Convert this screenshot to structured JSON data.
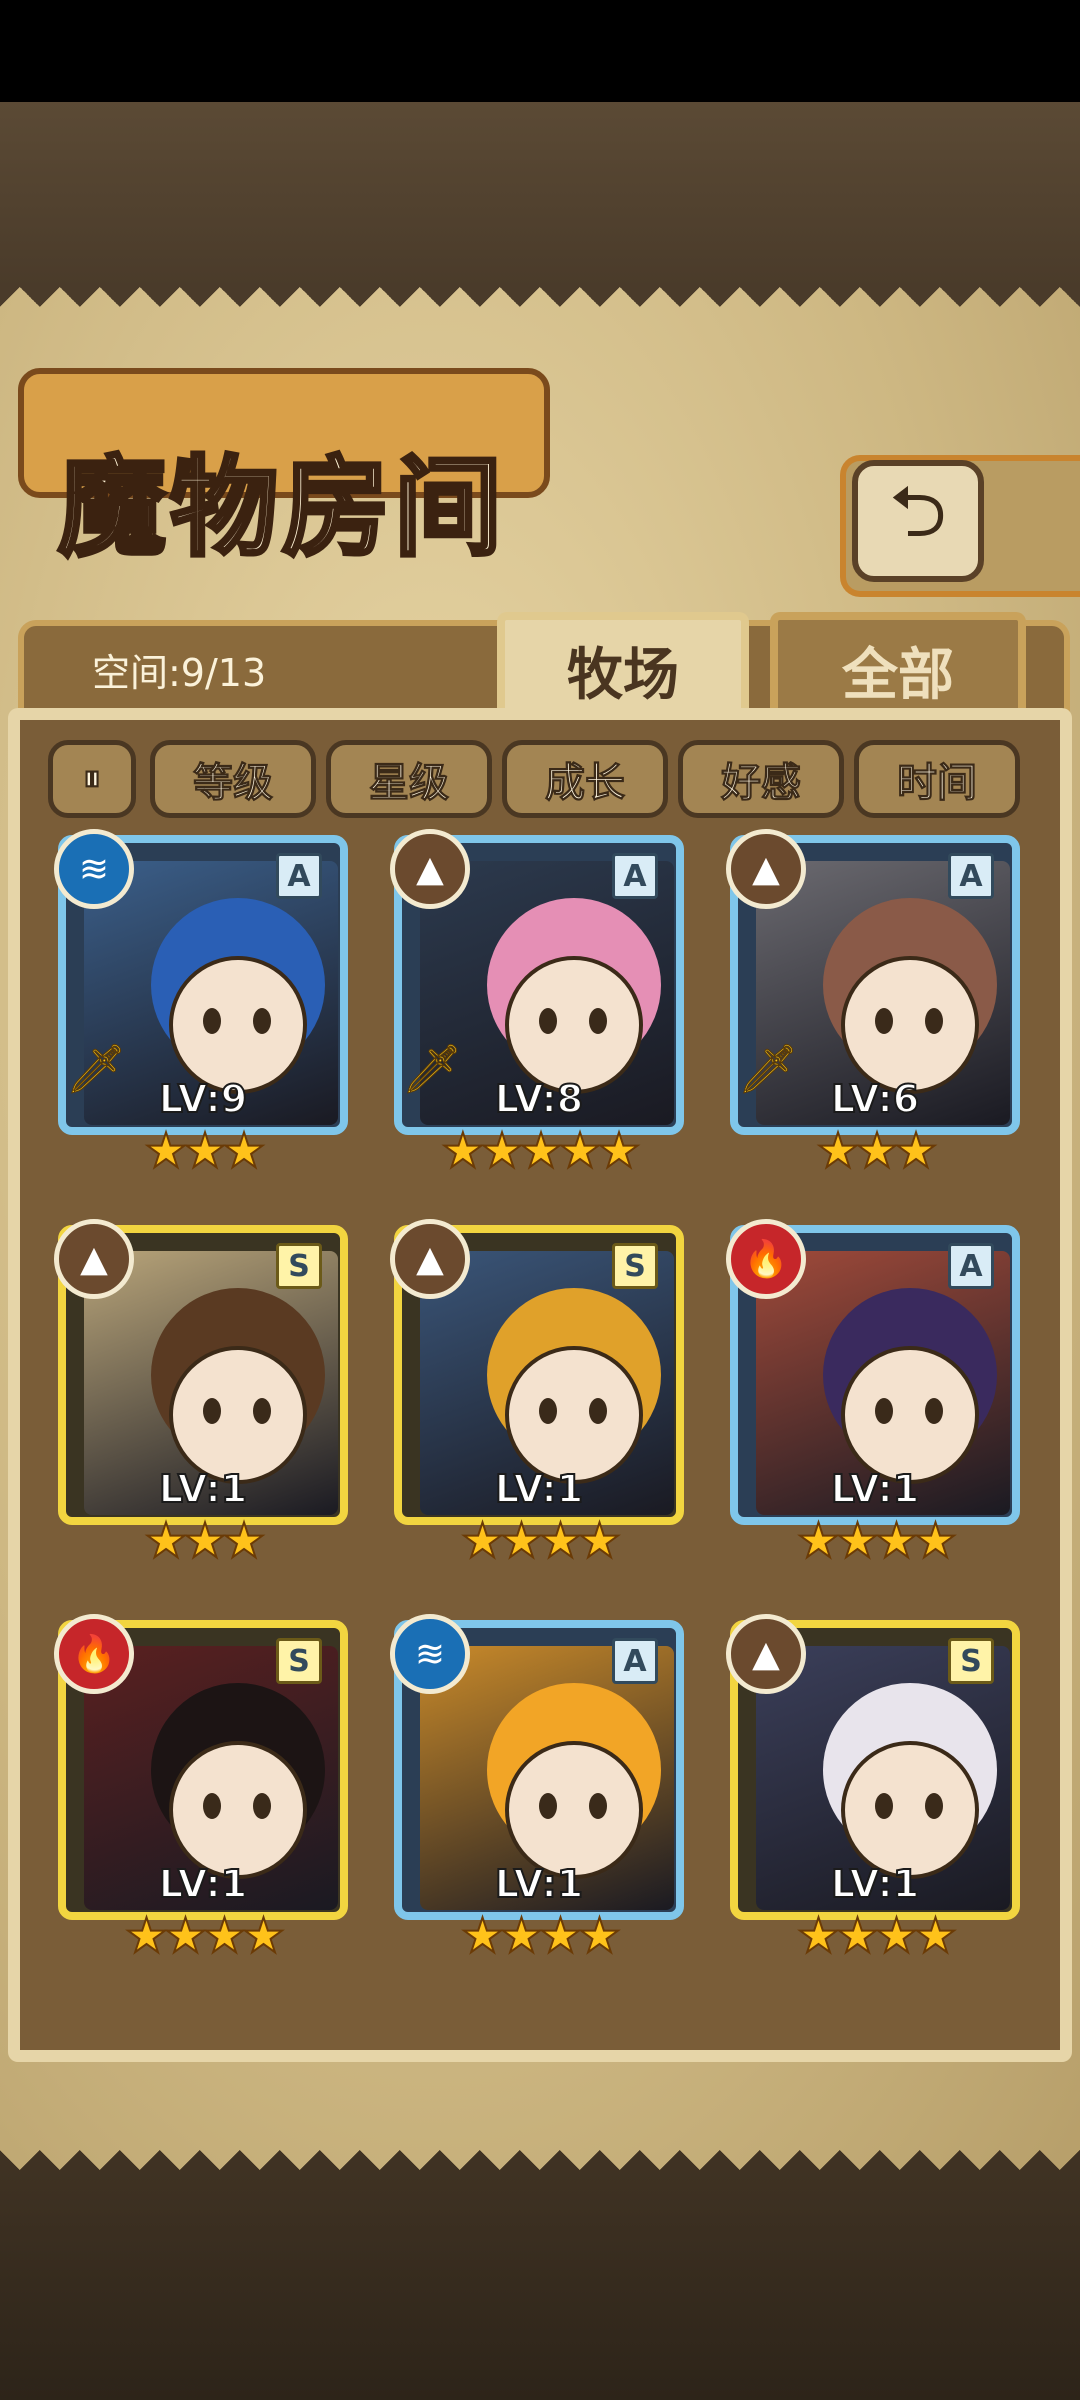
{
  "header": {
    "title": "魔物房间",
    "back_icon": "return-arrow-icon"
  },
  "space": {
    "label": "空间:9/13"
  },
  "tabs": [
    {
      "label": "牧场",
      "active": true
    },
    {
      "label": "全部",
      "active": false
    }
  ],
  "sort_buttons": [
    {
      "label": "等级"
    },
    {
      "label": "星级"
    },
    {
      "label": "成长"
    },
    {
      "label": "好感"
    },
    {
      "label": "时间"
    }
  ],
  "sort_toggle_icon": "pause-sort-icon",
  "monsters": [
    {
      "level": "LV:9",
      "stars": 3,
      "rank": "A",
      "element": "water",
      "frame": "blue",
      "equipped": true,
      "hair": "#2a5fb5",
      "bg": "#3b5f8a"
    },
    {
      "level": "LV:8",
      "stars": 5,
      "rank": "A",
      "element": "earth",
      "frame": "blue",
      "equipped": true,
      "hair": "#e58fb5",
      "bg": "#2c3a4e"
    },
    {
      "level": "LV:6",
      "stars": 3,
      "rank": "A",
      "element": "earth",
      "frame": "blue",
      "equipped": true,
      "hair": "#8a5a48",
      "bg": "#6b6a70"
    },
    {
      "level": "LV:1",
      "stars": 3,
      "rank": "S",
      "element": "earth",
      "frame": "gold",
      "equipped": false,
      "hair": "#5a3a22",
      "bg": "#b9a57a"
    },
    {
      "level": "LV:1",
      "stars": 4,
      "rank": "S",
      "element": "earth",
      "frame": "gold",
      "equipped": false,
      "hair": "#e0a12a",
      "bg": "#3a5578"
    },
    {
      "level": "LV:1",
      "stars": 4,
      "rank": "A",
      "element": "fire",
      "frame": "blue",
      "equipped": false,
      "hair": "#3a2a5e",
      "bg": "#a04a3a"
    },
    {
      "level": "LV:1",
      "stars": 4,
      "rank": "S",
      "element": "fire",
      "frame": "gold",
      "equipped": false,
      "hair": "#1c1414",
      "bg": "#5a2020"
    },
    {
      "level": "LV:1",
      "stars": 4,
      "rank": "A",
      "element": "water",
      "frame": "blue",
      "equipped": false,
      "hair": "#f2a526",
      "bg": "#c98a2a"
    },
    {
      "level": "LV:1",
      "stars": 4,
      "rank": "S",
      "element": "earth",
      "frame": "gold",
      "equipped": false,
      "hair": "#e8e4ec",
      "bg": "#3b3f5a"
    }
  ]
}
